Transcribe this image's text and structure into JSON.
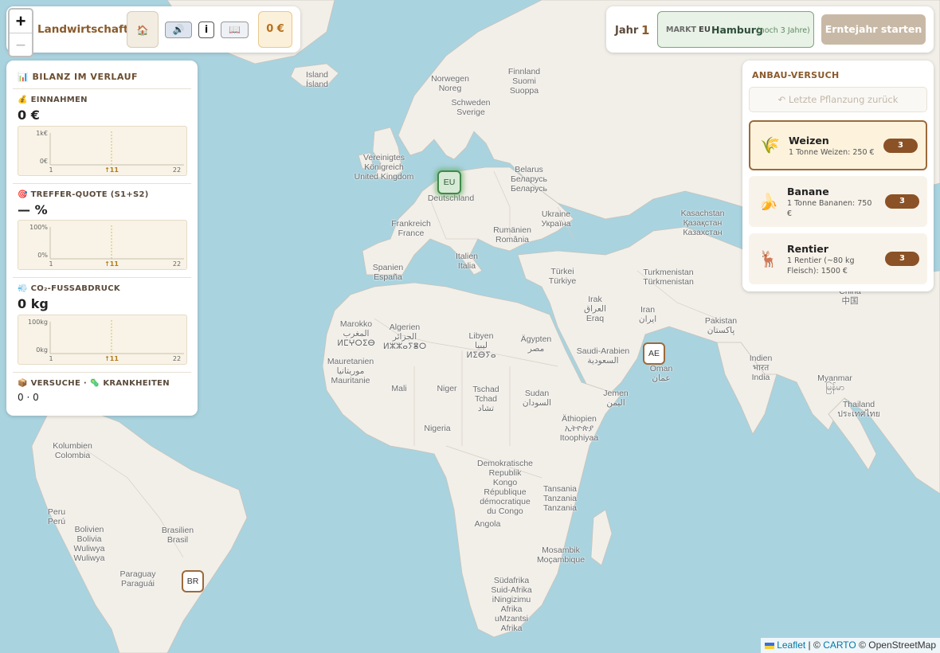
{
  "app": {
    "title": "Landwirtschaft",
    "money": "0 €"
  },
  "zoom": {
    "in": "+",
    "out": "−"
  },
  "toolbar": {
    "home_icon": "🏠",
    "sound_icon": "🔊",
    "info_icon": "i",
    "book_icon": "📖"
  },
  "stats": {
    "title": "BILANZ IM VERLAUF",
    "income": {
      "label": "EINNAHMEN",
      "value": "0 €",
      "y_top": "1k€",
      "y_bottom": "0€",
      "x_start": "1",
      "x_mid": "↑11",
      "x_end": "22"
    },
    "hit": {
      "label": "TREFFER-QUOTE (S1+S2)",
      "value": "— %",
      "y_top": "100%",
      "y_bottom": "0%",
      "x_start": "1",
      "x_mid": "↑11",
      "x_end": "22"
    },
    "co2": {
      "label": "CO₂-FUSSABDRUCK",
      "value": "0 kg",
      "y_top": "100kg",
      "y_bottom": "0kg",
      "x_start": "1",
      "x_mid": "↑11",
      "x_end": "22"
    },
    "trials_label": "VERSUCHE · ",
    "disease_label": " KRANKHEITEN",
    "trials_value": "0 · 0"
  },
  "yearbar": {
    "label": "Jahr",
    "year": "1",
    "market_label": "MARKT",
    "market_code": "EU",
    "market_name": "Hamburg",
    "market_note": "(noch 3 Jahre)",
    "start_button": "Erntejahr starten"
  },
  "anbau": {
    "title": "ANBAU-VERSUCH",
    "undo": "↶ Letzte Pflanzung zurück",
    "crops": [
      {
        "name": "Weizen",
        "desc": "1 Tonne Weizen: 250 €",
        "count": "3",
        "icon": "🌾"
      },
      {
        "name": "Banane",
        "desc": "1 Tonne Bananen: 750 €",
        "count": "3",
        "icon": "🍌"
      },
      {
        "name": "Rentier",
        "desc": "1 Rentier (~80 kg Fleisch): 1500 €",
        "count": "3",
        "icon": "🦌"
      }
    ]
  },
  "markers": [
    {
      "code": "EU",
      "active": true
    },
    {
      "code": "AE",
      "active": false
    },
    {
      "code": "BR",
      "active": false
    }
  ],
  "map_labels": [
    "Island\nÍsland",
    "Norwegen\nNoreg",
    "Finnland\nSuomi\nSuoppa",
    "Schweden\nSverige",
    "Vereinigtes\nKönigreich\nUnited Kingdom",
    "Deutschland",
    "Belarus\nБеларусь\nБеларусь",
    "Kasachstan\nҚазақстан\nКазахстан",
    "Ukraine\nУкраїна",
    "Frankreich\nFrance",
    "Rumänien\nRomânia",
    "Spanien\nEspaña",
    "Italien\nItalia",
    "Türkei\nTürkiye",
    "Turkmenistan\nTürkmenistan",
    "China\n中国",
    "Irak\nالعراق\nEraq",
    "Iran\nایران",
    "Pakistan\nپاکستان",
    "Marokko\nالمغرب\nⵍⵎⵖⵔⵉⴱ",
    "Algerien\nالجزائر\nⵍⵣⵣⴰⵢⴻⵔ",
    "Libyen\nليبيا\nⵍⵉⴱⵢⴰ",
    "Ägypten\nمصر",
    "Saudi-Arabien\nالسعودية",
    "Oman\nعمان",
    "Indien\nभारत\nIndia",
    "Myanmar\nမြန်မာ",
    "Thailand\nประเทศไทย",
    "Mauretanien\nموريتانيا\nMauritanie",
    "Mali",
    "Niger",
    "Tschad\nTchad\nتشاد",
    "Sudan\nالسودان",
    "Jemen\nاليمن",
    "Äthiopien\nኢትዮጵያ\nItoophiyaa",
    "Nigeria",
    "Kolumbien\nColombia",
    "Demokratische\nRepublik\nKongo\nRépublique\ndémocratique\ndu Congo",
    "Tansania\nTanzania\nTanzania",
    "Angola",
    "Peru\nPerú",
    "Bolivien\nBolivia\nWuliwya\nWuliwya",
    "Brasilien\nBrasil",
    "Paraguay\nParaguái",
    "Mosambik\nMoçambique",
    "Südafrika\nSuid-Afrika\niNingizimu\nAfrika\nuMzantsi\nAfrika"
  ],
  "attribution": {
    "leaflet": "Leaflet",
    "sep1": " | © ",
    "carto": "CARTO",
    "rest": " © OpenStreetMap"
  }
}
